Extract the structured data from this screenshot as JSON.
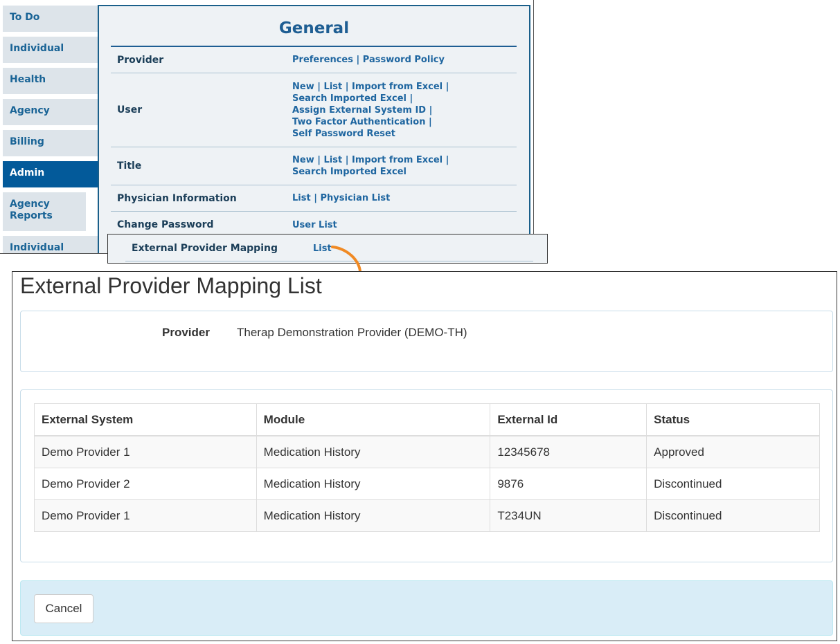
{
  "sidebar": {
    "items": [
      {
        "label": "To Do"
      },
      {
        "label": "Individual"
      },
      {
        "label": "Health"
      },
      {
        "label": "Agency"
      },
      {
        "label": "Billing"
      },
      {
        "label": "Admin",
        "active": true
      },
      {
        "label": "Agency Reports"
      },
      {
        "label": "Individual"
      }
    ]
  },
  "general": {
    "title": "General",
    "rows": [
      {
        "label": "Provider",
        "links": [
          "Preferences",
          "Password Policy"
        ]
      },
      {
        "label": "User",
        "links": [
          "New",
          "List",
          "Import from Excel",
          "Search Imported Excel",
          "Assign External System ID",
          "Two Factor Authentication",
          "Self Password Reset"
        ]
      },
      {
        "label": "Title",
        "links": [
          "New",
          "List",
          "Import from Excel",
          "Search Imported Excel"
        ]
      },
      {
        "label": "Physician Information",
        "links": [
          "List",
          "Physician List"
        ]
      },
      {
        "label": "Change Password",
        "links": [
          "User List"
        ]
      }
    ],
    "separator": "|"
  },
  "popup": {
    "label": "External Provider Mapping",
    "link": "List"
  },
  "mapping": {
    "title": "External Provider Mapping List",
    "provider_label": "Provider",
    "provider_value": "Therap Demonstration Provider (DEMO-TH)",
    "columns": [
      "External System",
      "Module",
      "External Id",
      "Status"
    ],
    "rows": [
      [
        "Demo Provider 1",
        "Medication History",
        "12345678",
        "Approved"
      ],
      [
        "Demo Provider 2",
        "Medication History",
        "9876",
        "Discontinued"
      ],
      [
        "Demo Provider 1",
        "Medication History",
        "T234UN",
        "Discontinued"
      ]
    ],
    "cancel_label": "Cancel"
  },
  "colors": {
    "nav_bg": "#dde4ea",
    "nav_active": "#035a9a",
    "link": "#1f66a0",
    "arrow": "#f08a24",
    "footer_bg": "#d9edf7"
  },
  "icons": {
    "arrow": "curved-arrow-down-icon"
  }
}
